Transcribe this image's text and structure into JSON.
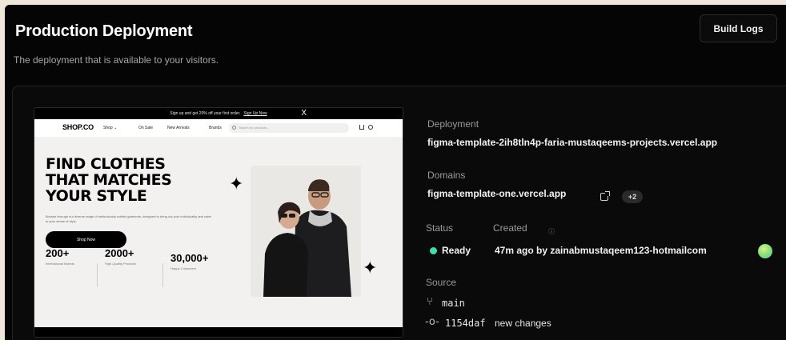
{
  "header": {
    "title": "Production Deployment",
    "subtitle": "The deployment that is available to your visitors.",
    "build_logs_label": "Build Logs"
  },
  "preview": {
    "topbar_text": "Sign up and get 20% off your first order.",
    "topbar_link": "Sign Up Now",
    "topbar_close": "X",
    "logo": "SHOP.CO",
    "nav_links": [
      "Shop ⌄",
      "On Sale",
      "New Arrivals",
      "Brands"
    ],
    "search_placeholder": "Search for products...",
    "hero_title_lines": [
      "FIND CLOTHES",
      "THAT MATCHES",
      "YOUR STYLE"
    ],
    "hero_description": "Browse through our diverse range of meticulously crafted garments, designed to bring out your individuality and cater to your sense of style.",
    "cta_label": "Shop Now",
    "stats": [
      {
        "value": "200+",
        "label": "International Brands"
      },
      {
        "value": "2000+",
        "label": "High-Quality Products"
      },
      {
        "value": "30,000+",
        "label": "Happy Customers"
      }
    ]
  },
  "details": {
    "deployment_label": "Deployment",
    "deployment_url": "figma-template-2ih8tln4p-faria-mustaqeems-projects.vercel.app",
    "domains_label": "Domains",
    "domain": "figma-template-one.vercel.app",
    "domain_extra_badge": "+2",
    "status_label": "Status",
    "created_label": "Created",
    "status_value": "Ready",
    "created_value": "47m ago by zainabmustaqeem123-hotmailcom",
    "source_label": "Source",
    "branch": "main",
    "commit_hash": "1154daf",
    "commit_message": "new changes"
  },
  "colors": {
    "ready": "#3ee0a8",
    "background": "#050505",
    "text_muted": "#9a9a9a"
  },
  "icons": {
    "external_link": "external-link-icon",
    "info": "info-icon",
    "branch": "git-branch-icon",
    "commit": "git-commit-icon"
  }
}
